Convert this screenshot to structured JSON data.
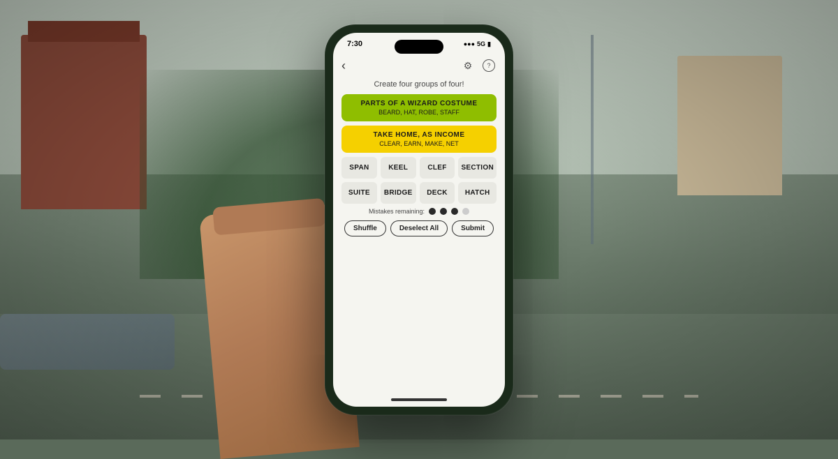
{
  "background": {
    "description": "Street scene background photo"
  },
  "phone": {
    "status_bar": {
      "time": "7:30",
      "lock_icon": "🔒",
      "signal": "●●●",
      "network": "5G",
      "battery": "🔋"
    },
    "app": {
      "nav": {
        "back_icon": "‹",
        "settings_icon": "⚙",
        "help_icon": "?"
      },
      "instruction": "Create four groups of four!",
      "solved_groups": [
        {
          "id": "green",
          "color_class": "group-green",
          "title": "PARTS OF A WIZARD COSTUME",
          "words": "BEARD, HAT, ROBE, STAFF"
        },
        {
          "id": "yellow",
          "color_class": "group-yellow",
          "title": "TAKE HOME, AS INCOME",
          "words": "CLEAR, EARN, MAKE, NET"
        }
      ],
      "word_tiles": [
        "SPAN",
        "KEEL",
        "CLEF",
        "SECTION",
        "SUITE",
        "BRIDGE",
        "DECK",
        "HATCH"
      ],
      "mistakes": {
        "label": "Mistakes remaining:",
        "filled": 3,
        "empty": 1,
        "total": 4
      },
      "buttons": [
        {
          "id": "shuffle",
          "label": "Shuffle"
        },
        {
          "id": "deselect",
          "label": "Deselect All"
        },
        {
          "id": "submit",
          "label": "Submit"
        }
      ]
    }
  }
}
